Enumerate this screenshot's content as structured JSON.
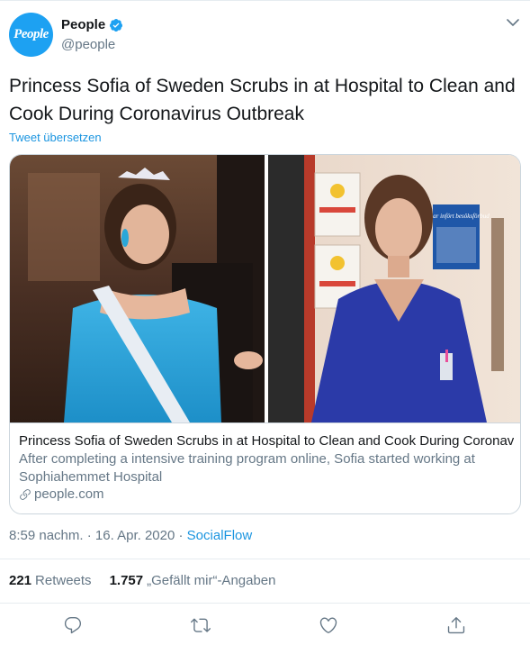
{
  "author": {
    "display_name": "People",
    "handle": "@people",
    "avatar_text": "People"
  },
  "tweet": {
    "text": "Princess Sofia of Sweden Scrubs in at Hospital to Clean and Cook During Coronavirus Outbreak",
    "translate_label": "Tweet übersetzen"
  },
  "card": {
    "title": "Princess Sofia of Sweden Scrubs in at Hospital to Clean and Cook During Coronavi...",
    "description": "After completing a intensive training program online, Sofia started working at Sophiahemmet Hospital",
    "domain": "people.com",
    "poster_text": "Vi har infört besöksförbud"
  },
  "meta": {
    "time": "8:59 nachm.",
    "separator": "·",
    "date": "16. Apr. 2020",
    "source": "SocialFlow"
  },
  "stats": {
    "retweets_count": "221",
    "retweets_label": "Retweets",
    "likes_count": "1.757",
    "likes_label": "„Gefällt mir“-Angaben"
  },
  "colors": {
    "accent": "#1da1f2",
    "link": "#1b95e0",
    "secondary_text": "#657786",
    "border": "#ccd6dd"
  },
  "icons": {
    "verified": "verified-badge-icon",
    "caret": "chevron-down-icon",
    "link": "link-icon",
    "reply": "reply-icon",
    "retweet": "retweet-icon",
    "like": "heart-icon",
    "share": "share-icon"
  }
}
